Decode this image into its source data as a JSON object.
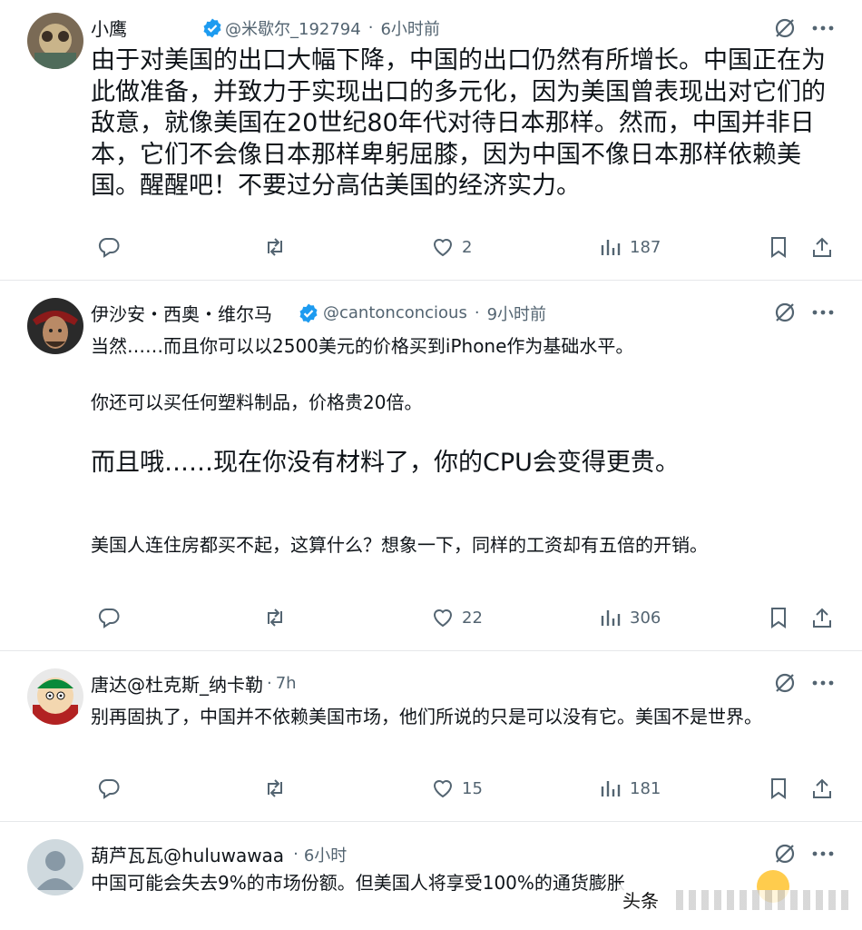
{
  "posts": [
    {
      "author": "小鹰",
      "verified": true,
      "handle": "@米歇尔_192794",
      "time": "6小时前",
      "text": "由于对美国的出口大幅下降，中国的出口仍然有所增长。中国正在为此做准备，并致力于实现出口的多元化，因为美国曾表现出对它们的敌意，就像美国在20世纪80年代对待日本那样。然而，中国并非日本，它们不会像日本那样卑躬屈膝，因为中国不像日本那样依赖美国。醒醒吧！不要过分高估美国的经济实力。",
      "likes": "2",
      "views": "187"
    },
    {
      "author": "伊沙安・西奥・维尔马",
      "verified": true,
      "handle": "@cantonconcious",
      "time": "9小时前",
      "paragraphs": [
        "当然……而且你可以以2500美元的价格买到iPhone作为基础水平。",
        "你还可以买任何塑料制品，价格贵20倍。",
        "而且哦……现在你没有材料了，你的CPU会变得更贵。",
        "美国人连住房都买不起，这算什么？想象一下，同样的工资却有五倍的开销。"
      ],
      "likes": "22",
      "views": "306"
    },
    {
      "author": "唐达@杜克斯_纳卡勒",
      "time": "7h",
      "text": "别再固执了，中国并不依赖美国市场，他们所说的只是可以没有它。美国不是世界。",
      "likes": "15",
      "views": "181"
    },
    {
      "author": "葫芦瓦瓦@huluwawaa",
      "time": "6小时",
      "text": "中国可能会失去9%的市场份额。但美国人将享受100%的通货膨胀"
    }
  ],
  "watermark": "头条",
  "colors": {
    "text": "#0f1419",
    "secondary": "#536471",
    "verified": "#1d9bf0",
    "divider": "#e6e8ea"
  },
  "icons": [
    "reply-icon",
    "repost-icon",
    "like-icon",
    "views-icon",
    "bookmark-icon",
    "share-icon",
    "grok-icon",
    "more-icon",
    "verified-icon"
  ]
}
